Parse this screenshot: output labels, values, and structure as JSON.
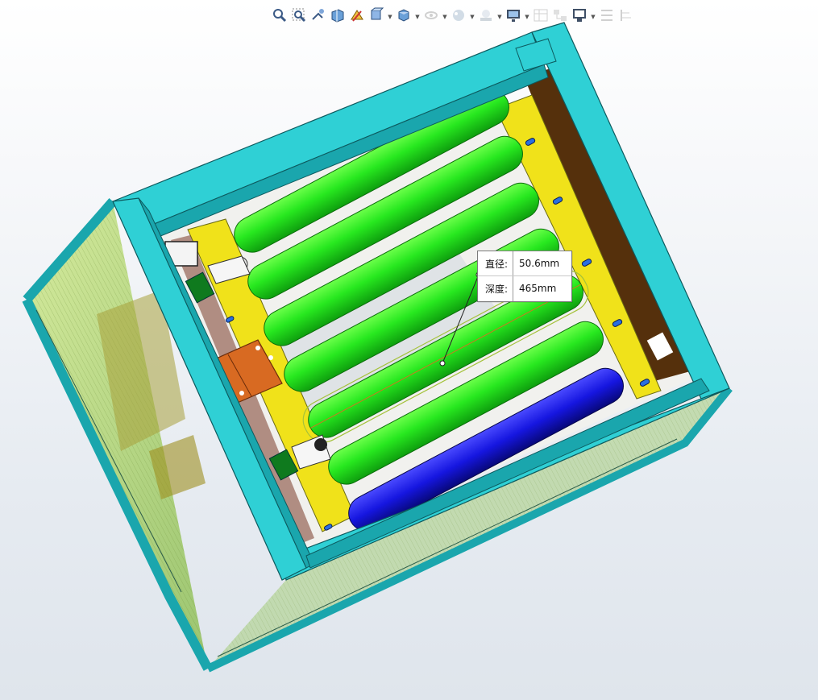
{
  "toolbar": {
    "items": [
      {
        "icon": "zoom-to-fit-icon",
        "caret": false,
        "enabled": true
      },
      {
        "icon": "zoom-to-area-icon",
        "caret": false,
        "enabled": true
      },
      {
        "icon": "previous-view-icon",
        "caret": false,
        "enabled": true
      },
      {
        "icon": "section-view-icon",
        "caret": false,
        "enabled": true
      },
      {
        "icon": "dynamic-annotation-icon",
        "caret": false,
        "enabled": true
      },
      {
        "icon": "view-orientation-icon",
        "caret": true,
        "enabled": true
      },
      {
        "icon": "display-style-icon",
        "caret": true,
        "enabled": true
      },
      {
        "icon": "hide-show-items-icon",
        "caret": true,
        "enabled": false
      },
      {
        "icon": "edit-appearance-icon",
        "caret": true,
        "enabled": false
      },
      {
        "icon": "apply-scene-icon",
        "caret": true,
        "enabled": false
      },
      {
        "icon": "view-settings-icon",
        "caret": true,
        "enabled": true
      },
      {
        "icon": "display-pane-icon",
        "caret": false,
        "enabled": false
      },
      {
        "icon": "configurations-icon",
        "caret": false,
        "enabled": false
      },
      {
        "icon": "render-tools-icon",
        "caret": true,
        "enabled": true
      },
      {
        "icon": "split-screen-icon",
        "caret": false,
        "enabled": false
      },
      {
        "icon": "feature-tree-icon",
        "caret": false,
        "enabled": false
      }
    ]
  },
  "measurement": {
    "diameter_label": "直径:",
    "diameter_value": "50.6mm",
    "depth_label": "深度:",
    "depth_value": "465mm"
  },
  "colors": {
    "frame": "#2fd0d5",
    "roller_green": "#21e021",
    "roller_blue": "#1414d8",
    "yellow_plate": "#f0e21a",
    "brown_panel": "#55300c",
    "orange_bracket": "#d86a22",
    "glass_tint": "#b8dc7a"
  }
}
